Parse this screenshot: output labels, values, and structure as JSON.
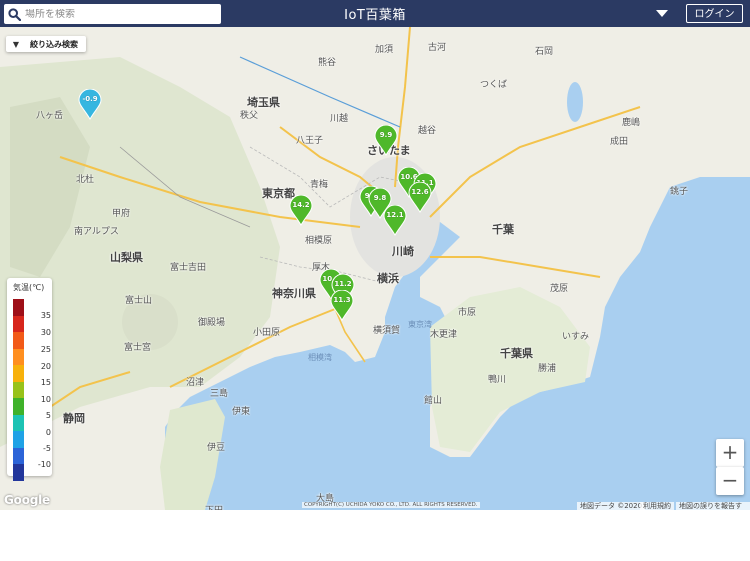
{
  "header": {
    "title": "IoT百葉箱",
    "search_placeholder": "場所を検索",
    "login_label": "ログイン"
  },
  "map": {
    "filter_label": "絞り込み検索",
    "places": {
      "saitama_pref": "埼玉県",
      "tokyo": "東京都",
      "yamanashi": "山梨県",
      "kanagawa": "神奈川県",
      "chiba_pref": "千葉県",
      "chiba": "千葉",
      "kawasaki": "川崎",
      "yokohama": "横浜",
      "yokosuka": "横須賀",
      "saitama": "さいたま",
      "shizuoka": "静岡",
      "fujisan": "富士山",
      "yatsugatake": "八ヶ岳",
      "kofu": "甲府",
      "sagamihara": "相模原",
      "odawara": "小田原",
      "ito": "伊豆",
      "kisarazu": "木更津",
      "choshi": "銚子",
      "narita": "成田",
      "kashima": "鹿嶋",
      "tsukuba": "つくば",
      "chichibu": "秩父",
      "hachioji": "八王子",
      "ome": "青梅",
      "atsugi": "厚木",
      "fujiyoshida": "富士吉田",
      "gotemba": "御殿場",
      "numazu": "沼津",
      "mishima": "三島",
      "kamogawa": "鴨川",
      "tateyama": "館山",
      "ichihara": "市原",
      "mobara": "茂原",
      "isumi": "いすみ",
      "katsuura": "勝浦",
      "sagami_bay": "相模湾",
      "tokyo_bay": "東京湾",
      "fujinomiya": "富士宮",
      "minami_alps": "南アルプス",
      "hokuto": "北杜",
      "itoi": "伊東",
      "oshima": "大島",
      "shimoda": "下田",
      "koshigaya": "越谷",
      "kawagoe": "川越",
      "kumagaya": "熊谷",
      "ishioka": "石岡",
      "kazo": "加須",
      "koga": "古河"
    },
    "pins": [
      {
        "value": "-0.9",
        "color": "#36b6e0"
      },
      {
        "value": "9.9",
        "color": "#4fb82a"
      },
      {
        "value": "10.6",
        "color": "#4fb82a"
      },
      {
        "value": "11.1",
        "color": "#4fb82a"
      },
      {
        "value": "12.6",
        "color": "#4fb82a"
      },
      {
        "value": "9.9",
        "color": "#4fb82a"
      },
      {
        "value": "9.8",
        "color": "#4fb82a"
      },
      {
        "value": "12.1",
        "color": "#4fb82a"
      },
      {
        "value": "14.2",
        "color": "#4fb82a"
      },
      {
        "value": "10.5",
        "color": "#4fb82a"
      },
      {
        "value": "11.2",
        "color": "#4fb82a"
      },
      {
        "value": "11.3",
        "color": "#4fb82a"
      }
    ],
    "legend": {
      "title": "気温(℃)",
      "ticks": [
        "35",
        "30",
        "25",
        "20",
        "15",
        "10",
        "5",
        "0",
        "-5",
        "-10"
      ],
      "colors": [
        "#9e0f18",
        "#d7261c",
        "#f25a18",
        "#ff8f1f",
        "#f7b10b",
        "#98c21a",
        "#3fb22a",
        "#1dc3b4",
        "#1fa2e6",
        "#2c64d8",
        "#22369b"
      ]
    },
    "zoom_in_label": "+",
    "zoom_out_label": "−",
    "google_logo": "Google",
    "copyright": "COPYRIGHT(C) UCHIDA YOKO CO., LTD. ALL RIGHTS RESERVED.",
    "map_data": "地図データ ©2020",
    "terms": "利用規約",
    "report": "地図の誤りを報告する"
  }
}
